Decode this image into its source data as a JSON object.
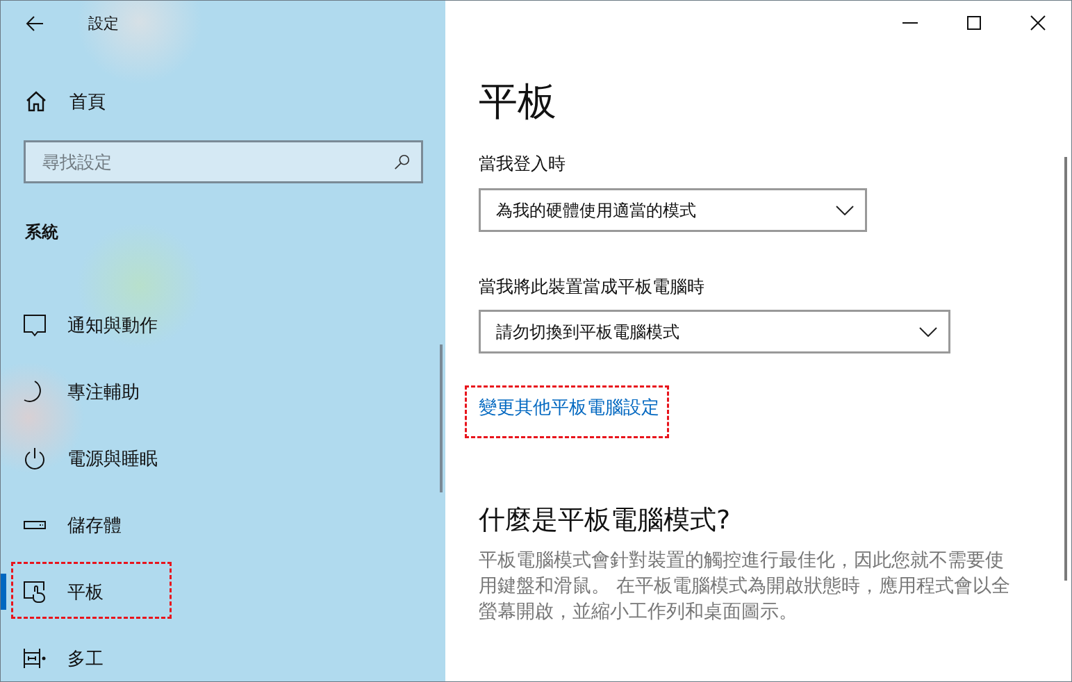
{
  "window": {
    "title": "設定"
  },
  "sidebar": {
    "home": "首頁",
    "search": {
      "placeholder": "尋找設定"
    },
    "section": "系統",
    "items": [
      {
        "label": "通知與動作",
        "kind": "message",
        "selected": false,
        "highlighted": false
      },
      {
        "label": "專注輔助",
        "kind": "moon",
        "selected": false,
        "highlighted": false
      },
      {
        "label": "電源與睡眠",
        "kind": "power",
        "selected": false,
        "highlighted": false
      },
      {
        "label": "儲存體",
        "kind": "drive",
        "selected": false,
        "highlighted": false
      },
      {
        "label": "平板",
        "kind": "tablet",
        "selected": true,
        "highlighted": true
      },
      {
        "label": "多工",
        "kind": "multitask",
        "selected": false,
        "highlighted": false
      }
    ]
  },
  "page": {
    "title": "平板",
    "settings": [
      {
        "label": "當我登入時",
        "value": "為我的硬體使用適當的模式"
      },
      {
        "label": "當我將此裝置當成平板電腦時",
        "value": "請勿切換到平板電腦模式"
      }
    ],
    "link": {
      "text": "變更其他平板電腦設定",
      "highlighted": true
    },
    "help": {
      "title": "什麼是平板電腦模式?",
      "body": "平板電腦模式會針對裝置的觸控進行最佳化，因此您就不需要使用鍵盤和滑鼠。 在平板電腦模式為開啟狀態時，應用程式會以全螢幕開啟，並縮小工作列和桌面圖示。"
    }
  }
}
